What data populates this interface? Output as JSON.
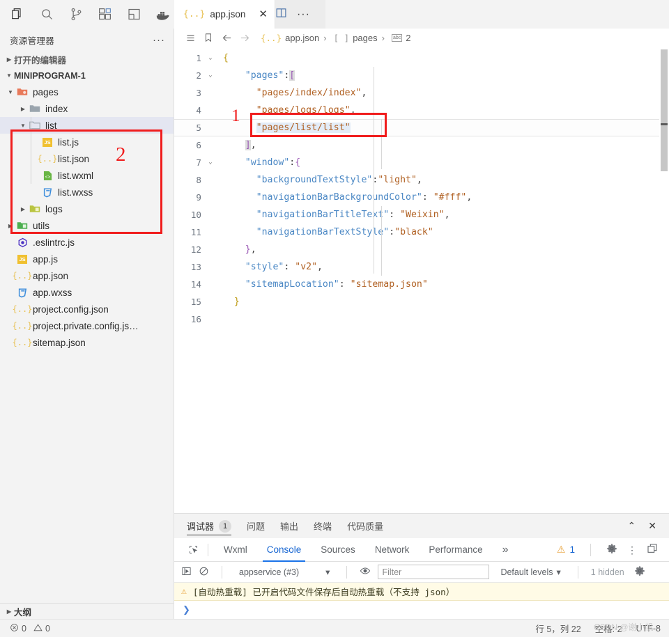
{
  "activitybar": {
    "icons": [
      {
        "name": "explorer-icon",
        "label": "资源管理器"
      },
      {
        "name": "search-icon",
        "label": "搜索"
      },
      {
        "name": "source-control-icon",
        "label": "源代码管理"
      },
      {
        "name": "extensions-icon",
        "label": "扩展"
      },
      {
        "name": "layout-icon",
        "label": "布局"
      },
      {
        "name": "docker-icon",
        "label": "Docker"
      }
    ]
  },
  "sidebar": {
    "title": "资源管理器",
    "more_label": "···",
    "open_editors_label": "打开的编辑器",
    "project_label": "MINIPROGRAM-1",
    "outline_label": "大纲",
    "problems": {
      "errors": "0",
      "warnings": "0"
    },
    "tree": [
      {
        "label": "pages",
        "depth": 1,
        "type": "folder",
        "icon": "folder-pages-icon",
        "expanded": true,
        "selected": false
      },
      {
        "label": "index",
        "depth": 2,
        "type": "folder",
        "icon": "folder-icon",
        "expanded": false,
        "selected": false
      },
      {
        "label": "list",
        "depth": 2,
        "type": "folder",
        "icon": "folder-open-icon",
        "expanded": true,
        "selected": true
      },
      {
        "label": "list.js",
        "depth": 3,
        "type": "file",
        "icon": "js-file-icon",
        "expanded": null,
        "selected": false
      },
      {
        "label": "list.json",
        "depth": 3,
        "type": "file",
        "icon": "json-file-icon",
        "expanded": null,
        "selected": false
      },
      {
        "label": "list.wxml",
        "depth": 3,
        "type": "file",
        "icon": "wxml-file-icon",
        "expanded": null,
        "selected": false
      },
      {
        "label": "list.wxss",
        "depth": 3,
        "type": "file",
        "icon": "wxss-file-icon",
        "expanded": null,
        "selected": false
      },
      {
        "label": "logs",
        "depth": 2,
        "type": "folder",
        "icon": "folder-logs-icon",
        "expanded": false,
        "selected": false
      },
      {
        "label": "utils",
        "depth": 1,
        "type": "folder",
        "icon": "folder-utils-icon",
        "expanded": false,
        "selected": false
      },
      {
        "label": ".eslintrc.js",
        "depth": 1,
        "type": "file",
        "icon": "eslint-file-icon",
        "expanded": null,
        "selected": false
      },
      {
        "label": "app.js",
        "depth": 1,
        "type": "file",
        "icon": "js-file-icon",
        "expanded": null,
        "selected": false
      },
      {
        "label": "app.json",
        "depth": 1,
        "type": "file",
        "icon": "json-file-icon",
        "expanded": null,
        "selected": false
      },
      {
        "label": "app.wxss",
        "depth": 1,
        "type": "file",
        "icon": "wxss-file-icon",
        "expanded": null,
        "selected": false
      },
      {
        "label": "project.config.json",
        "depth": 1,
        "type": "file",
        "icon": "json-file-icon",
        "expanded": null,
        "selected": false
      },
      {
        "label": "project.private.config.js…",
        "depth": 1,
        "type": "file",
        "icon": "json-file-icon",
        "expanded": null,
        "selected": false
      },
      {
        "label": "sitemap.json",
        "depth": 1,
        "type": "file",
        "icon": "json-file-icon",
        "expanded": null,
        "selected": false
      }
    ]
  },
  "editor": {
    "tab": {
      "label": "app.json",
      "icon": "json-file-icon",
      "close": "✕"
    },
    "tab_actions": [
      {
        "name": "split-editor-icon"
      },
      {
        "name": "more-actions-icon",
        "label": "···"
      }
    ],
    "breadcrumb": {
      "buttons": [
        "outline-icon",
        "bookmark-icon",
        "back-arrow-icon",
        "forward-arrow-icon"
      ],
      "segments": [
        {
          "icon": "json-file-icon",
          "label": "app.json"
        },
        {
          "icon": "array-icon",
          "label": "pages"
        },
        {
          "icon": "string-icon",
          "label": "2"
        }
      ],
      "separator": "❯"
    },
    "lines": [
      {
        "n": "1",
        "fold": "⌄",
        "active": false,
        "parts": [
          {
            "t": "{",
            "c": "tok-punct"
          }
        ]
      },
      {
        "n": "2",
        "fold": "⌄",
        "active": false,
        "parts": [
          {
            "t": "    ",
            "c": ""
          },
          {
            "t": "\"pages\"",
            "c": "tok-key"
          },
          {
            "t": ":",
            "c": "tok-colon"
          },
          {
            "t": "[",
            "c": "tok-bracket-box"
          }
        ]
      },
      {
        "n": "3",
        "fold": "",
        "active": false,
        "parts": [
          {
            "t": "      ",
            "c": ""
          },
          {
            "t": "\"pages/index/index\"",
            "c": "tok-str"
          },
          {
            "t": ",",
            "c": "tok-comma"
          }
        ]
      },
      {
        "n": "4",
        "fold": "",
        "active": false,
        "parts": [
          {
            "t": "      ",
            "c": ""
          },
          {
            "t": "\"pages/logs/logs\"",
            "c": "tok-str"
          },
          {
            "t": ",",
            "c": "tok-comma"
          }
        ]
      },
      {
        "n": "5",
        "fold": "",
        "active": true,
        "parts": [
          {
            "t": "      ",
            "c": ""
          },
          {
            "t": "\"pages/list/list\"",
            "c": "tok-str sel-text"
          }
        ]
      },
      {
        "n": "6",
        "fold": "",
        "active": false,
        "parts": [
          {
            "t": "    ",
            "c": ""
          },
          {
            "t": "]",
            "c": "tok-bracket-box"
          },
          {
            "t": ",",
            "c": "tok-comma"
          }
        ]
      },
      {
        "n": "7",
        "fold": "⌄",
        "active": false,
        "parts": [
          {
            "t": "    ",
            "c": ""
          },
          {
            "t": "\"window\"",
            "c": "tok-key"
          },
          {
            "t": ":",
            "c": "tok-colon"
          },
          {
            "t": "{",
            "c": "tok-brace"
          }
        ]
      },
      {
        "n": "8",
        "fold": "",
        "active": false,
        "parts": [
          {
            "t": "      ",
            "c": ""
          },
          {
            "t": "\"backgroundTextStyle\"",
            "c": "tok-key"
          },
          {
            "t": ":",
            "c": "tok-colon"
          },
          {
            "t": "\"light\"",
            "c": "tok-str"
          },
          {
            "t": ",",
            "c": "tok-comma"
          }
        ]
      },
      {
        "n": "9",
        "fold": "",
        "active": false,
        "parts": [
          {
            "t": "      ",
            "c": ""
          },
          {
            "t": "\"navigationBarBackgroundColor\"",
            "c": "tok-key"
          },
          {
            "t": ":",
            "c": "tok-colon"
          },
          {
            "t": " ",
            "c": ""
          },
          {
            "t": "\"#fff\"",
            "c": "tok-str"
          },
          {
            "t": ",",
            "c": "tok-comma"
          }
        ]
      },
      {
        "n": "10",
        "fold": "",
        "active": false,
        "parts": [
          {
            "t": "      ",
            "c": ""
          },
          {
            "t": "\"navigationBarTitleText\"",
            "c": "tok-key"
          },
          {
            "t": ":",
            "c": "tok-colon"
          },
          {
            "t": " ",
            "c": ""
          },
          {
            "t": "\"Weixin\"",
            "c": "tok-str"
          },
          {
            "t": ",",
            "c": "tok-comma"
          }
        ]
      },
      {
        "n": "11",
        "fold": "",
        "active": false,
        "parts": [
          {
            "t": "      ",
            "c": ""
          },
          {
            "t": "\"navigationBarTextStyle\"",
            "c": "tok-key"
          },
          {
            "t": ":",
            "c": "tok-colon"
          },
          {
            "t": "\"black\"",
            "c": "tok-str"
          }
        ]
      },
      {
        "n": "12",
        "fold": "",
        "active": false,
        "parts": [
          {
            "t": "    ",
            "c": ""
          },
          {
            "t": "}",
            "c": "tok-brace"
          },
          {
            "t": ",",
            "c": "tok-comma"
          }
        ]
      },
      {
        "n": "13",
        "fold": "",
        "active": false,
        "parts": [
          {
            "t": "    ",
            "c": ""
          },
          {
            "t": "\"style\"",
            "c": "tok-key"
          },
          {
            "t": ":",
            "c": "tok-colon"
          },
          {
            "t": " ",
            "c": ""
          },
          {
            "t": "\"v2\"",
            "c": "tok-str"
          },
          {
            "t": ",",
            "c": "tok-comma"
          }
        ]
      },
      {
        "n": "14",
        "fold": "",
        "active": false,
        "parts": [
          {
            "t": "    ",
            "c": ""
          },
          {
            "t": "\"sitemapLocation\"",
            "c": "tok-key"
          },
          {
            "t": ":",
            "c": "tok-colon"
          },
          {
            "t": " ",
            "c": ""
          },
          {
            "t": "\"sitemap.json\"",
            "c": "tok-str"
          }
        ]
      },
      {
        "n": "15",
        "fold": "",
        "active": false,
        "parts": [
          {
            "t": "  ",
            "c": ""
          },
          {
            "t": "}",
            "c": "tok-punct"
          }
        ]
      },
      {
        "n": "16",
        "fold": "",
        "active": false,
        "parts": []
      }
    ]
  },
  "panel": {
    "tabs": [
      {
        "label": "调试器",
        "badge": "1",
        "active": true
      },
      {
        "label": "问题",
        "badge": null,
        "active": false
      },
      {
        "label": "输出",
        "badge": null,
        "active": false
      },
      {
        "label": "终端",
        "badge": null,
        "active": false
      },
      {
        "label": "代码质量",
        "badge": null,
        "active": false
      }
    ],
    "actions": [
      {
        "name": "collapse-panel-icon",
        "label": "⌃"
      },
      {
        "name": "close-panel-icon",
        "label": "✕"
      }
    ],
    "devtools": {
      "inspect_icon": "inspect-element-icon",
      "tabs": [
        {
          "label": "Wxml",
          "active": false
        },
        {
          "label": "Console",
          "active": true
        },
        {
          "label": "Sources",
          "active": false
        },
        {
          "label": "Network",
          "active": false
        },
        {
          "label": "Performance",
          "active": false
        }
      ],
      "overflow": "»",
      "warning_count": "1",
      "right_icons": [
        "settings-gear-icon",
        "more-vertical-icon",
        "dock-panel-icon"
      ]
    },
    "console": {
      "toolbar": {
        "execute_icon": "execute-icon",
        "clear_icon": "clear-console-icon",
        "context": "appservice (#3)",
        "context_caret": "▾",
        "eye_icon": "live-expression-icon",
        "filter_placeholder": "Filter",
        "filter_value": "",
        "levels": "Default levels",
        "levels_caret": "▾",
        "hidden": "1 hidden",
        "settings_icon": "settings-gear-icon"
      },
      "messages": [
        {
          "icon": "warning-icon",
          "text": "[自动热重载] 已开启代码文件保存后自动热重载（不支持 json）"
        }
      ],
      "prompt": "❯"
    }
  },
  "statusbar": {
    "left": [],
    "right": [
      {
        "name": "cursor-position",
        "label": "行 5，列 22"
      },
      {
        "name": "indentation",
        "label": "空格: 2"
      },
      {
        "name": "encoding",
        "label": "UTF-8"
      }
    ]
  },
  "annotations": [
    {
      "name": "annotation-number-1",
      "label": "1"
    },
    {
      "name": "annotation-number-2",
      "label": "2"
    }
  ],
  "watermark": {
    "text": "CSDN @谢小帆"
  }
}
